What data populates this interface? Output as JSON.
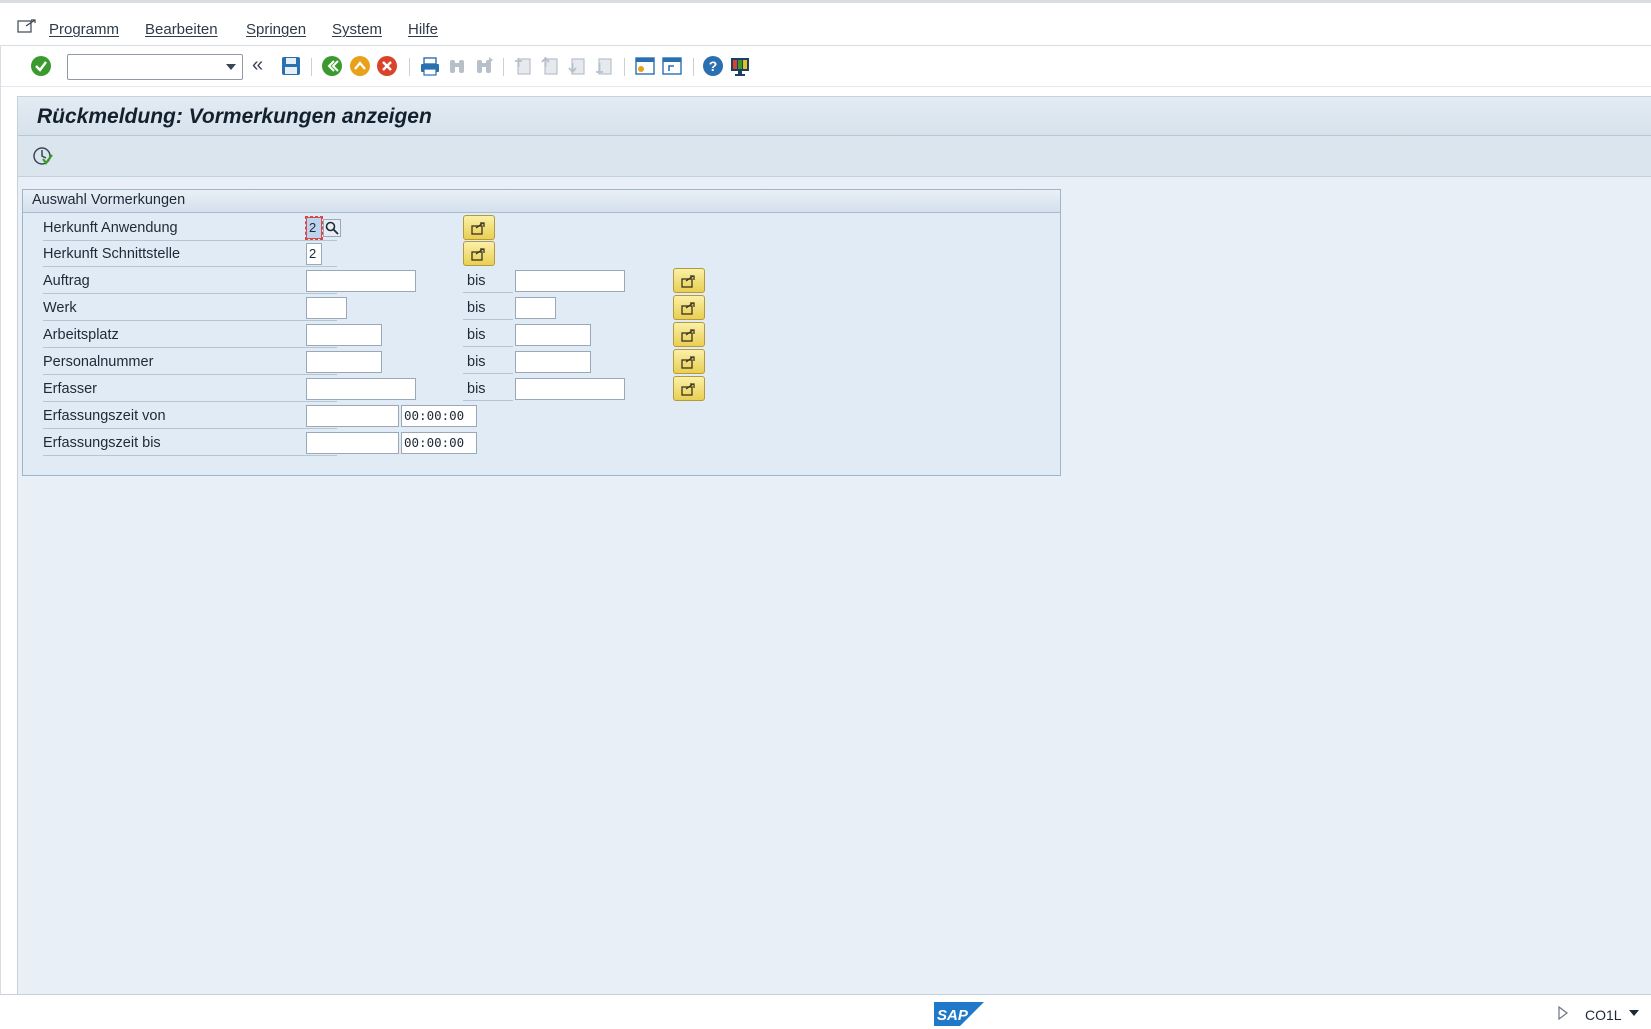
{
  "menu": {
    "items": [
      {
        "label": "Programm"
      },
      {
        "label": "Bearbeiten"
      },
      {
        "label": "Springen"
      },
      {
        "label": "System"
      },
      {
        "label": "Hilfe"
      }
    ]
  },
  "toolbar": {
    "command_field_value": ""
  },
  "page": {
    "title": "Rückmeldung: Vormerkungen anzeigen"
  },
  "group": {
    "title": "Auswahl Vormerkungen",
    "rows": [
      {
        "label": "Herkunft Anwendung",
        "value": "2"
      },
      {
        "label": "Herkunft Schnittstelle",
        "value": "2"
      },
      {
        "label": "Auftrag",
        "from": "",
        "to_label": "bis",
        "to": ""
      },
      {
        "label": "Werk",
        "from": "",
        "to_label": "bis",
        "to": ""
      },
      {
        "label": "Arbeitsplatz",
        "from": "",
        "to_label": "bis",
        "to": ""
      },
      {
        "label": "Personalnummer",
        "from": "",
        "to_label": "bis",
        "to": ""
      },
      {
        "label": "Erfasser",
        "from": "",
        "to_label": "bis",
        "to": ""
      },
      {
        "label": "Erfassungszeit von",
        "date": "",
        "time": "00:00:00"
      },
      {
        "label": "Erfassungszeit bis",
        "date": "",
        "time": "00:00:00"
      }
    ]
  },
  "statusbar": {
    "logo_text": "SAP",
    "transaction": "CO1L"
  },
  "colors": {
    "accent_green": "#3a9a2e",
    "accent_orange": "#e8a21a",
    "accent_red": "#d9432a",
    "sap_blue": "#1f78c8",
    "button_yellow": "#f2dc6a"
  }
}
